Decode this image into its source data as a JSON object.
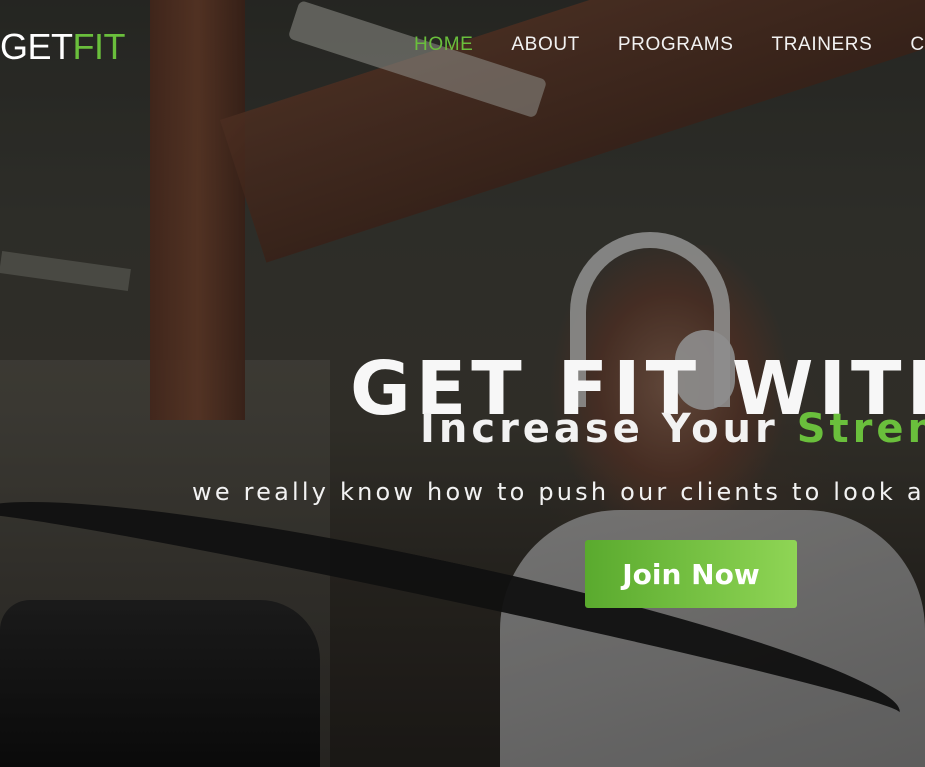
{
  "brand": {
    "logo_primary": "GET",
    "logo_accent": "FIT",
    "accent_color": "#6abf3c"
  },
  "nav": {
    "items": [
      {
        "label": "HOME",
        "active": true
      },
      {
        "label": "ABOUT",
        "active": false
      },
      {
        "label": "PROGRAMS",
        "active": false
      },
      {
        "label": "TRAINERS",
        "active": false
      },
      {
        "label": "C",
        "active": false
      }
    ]
  },
  "hero": {
    "headline": "GET FIT WITH",
    "subhead_prefix": "Increase Your ",
    "subhead_accent": "Strengt",
    "tagline": "we really know how to push our clients to look a",
    "cta_label": "Join Now",
    "cta_colors": [
      "#5aaa2e",
      "#8fd555"
    ]
  }
}
